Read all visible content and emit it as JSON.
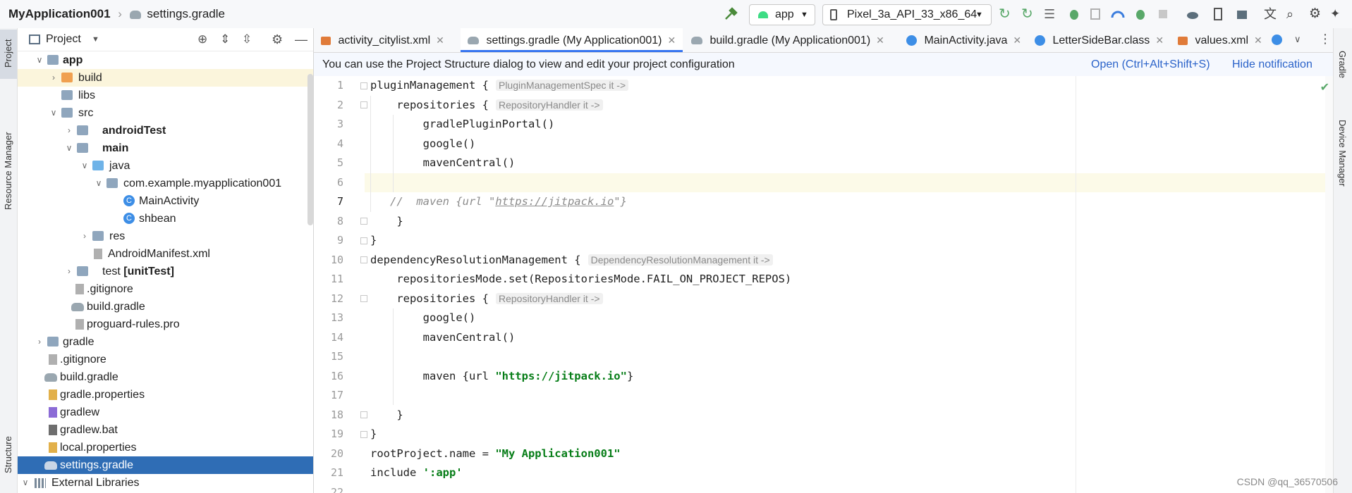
{
  "topbar": {
    "project_name": "MyApplication001",
    "file_name": "settings.gradle",
    "run_config": "app",
    "device": "Pixel_3a_API_33_x86_64"
  },
  "left_strip": {
    "project_label": "Project",
    "resource_label": "Resource Manager",
    "structure_label": "Structure"
  },
  "right_strip": {
    "gradle_label": "Gradle",
    "device_label": "Device Manager"
  },
  "project_panel": {
    "title": "Project",
    "items": [
      {
        "label": "app",
        "bold": true
      },
      {
        "label": "build"
      },
      {
        "label": "libs"
      },
      {
        "label": "src"
      },
      {
        "label": "androidTest",
        "bold": true
      },
      {
        "label": "main",
        "bold": true
      },
      {
        "label": "java"
      },
      {
        "label": "com.example.myapplication001"
      },
      {
        "label": "MainActivity"
      },
      {
        "label": "shbean"
      },
      {
        "label": "res"
      },
      {
        "label": "AndroidManifest.xml"
      },
      {
        "label": "test",
        "suffix": "[unitTest]"
      },
      {
        "label": ".gitignore"
      },
      {
        "label": "build.gradle"
      },
      {
        "label": "proguard-rules.pro"
      },
      {
        "label": "gradle"
      },
      {
        "label": ".gitignore"
      },
      {
        "label": "build.gradle"
      },
      {
        "label": "gradle.properties"
      },
      {
        "label": "gradlew"
      },
      {
        "label": "gradlew.bat"
      },
      {
        "label": "local.properties"
      },
      {
        "label": "settings.gradle"
      },
      {
        "label": "External Libraries"
      }
    ]
  },
  "tabs": [
    {
      "label": "activity_citylist.xml"
    },
    {
      "label": "settings.gradle (My Application001)"
    },
    {
      "label": "build.gradle (My Application001)"
    },
    {
      "label": "MainActivity.java"
    },
    {
      "label": "LetterSideBar.class"
    },
    {
      "label": "values.xml"
    }
  ],
  "notification": {
    "message": "You can use the Project Structure dialog to view and edit your project configuration",
    "open_link": "Open (Ctrl+Alt+Shift+S)",
    "hide_link": "Hide notification"
  },
  "code": {
    "line_numbers": [
      "1",
      "2",
      "3",
      "4",
      "5",
      "6",
      "7",
      "8",
      "9",
      "10",
      "11",
      "12",
      "13",
      "14",
      "15",
      "16",
      "17",
      "18",
      "19",
      "20",
      "21",
      "22"
    ],
    "l1": "pluginManagement {",
    "h1": "PluginManagementSpec it ->",
    "l2": "    repositories {",
    "h2": "RepositoryHandler it ->",
    "l3": "        gradlePluginPortal()",
    "l4": "        google()",
    "l5": "        mavenCentral()",
    "l7a": "   //  maven {url \"",
    "l7url": "https://jitpack.io",
    "l7b": "\"}",
    "l8": "    }",
    "l9": "}",
    "l10": "dependencyResolutionManagement {",
    "h10": "DependencyResolutionManagement it ->",
    "l11": "    repositoriesMode.set(RepositoriesMode.FAIL_ON_PROJECT_REPOS)",
    "l12": "    repositories {",
    "h12": "RepositoryHandler it ->",
    "l13": "        google()",
    "l14": "        mavenCentral()",
    "l16a": "        maven {url ",
    "l16s": "\"https://jitpack.io\"",
    "l16b": "}",
    "l18": "    }",
    "l19": "}",
    "l20a": "rootProject.name = ",
    "l20s": "\"My Application001\"",
    "l21a": "include ",
    "l21s": "':app'"
  },
  "watermark": "CSDN @qq_36570506"
}
